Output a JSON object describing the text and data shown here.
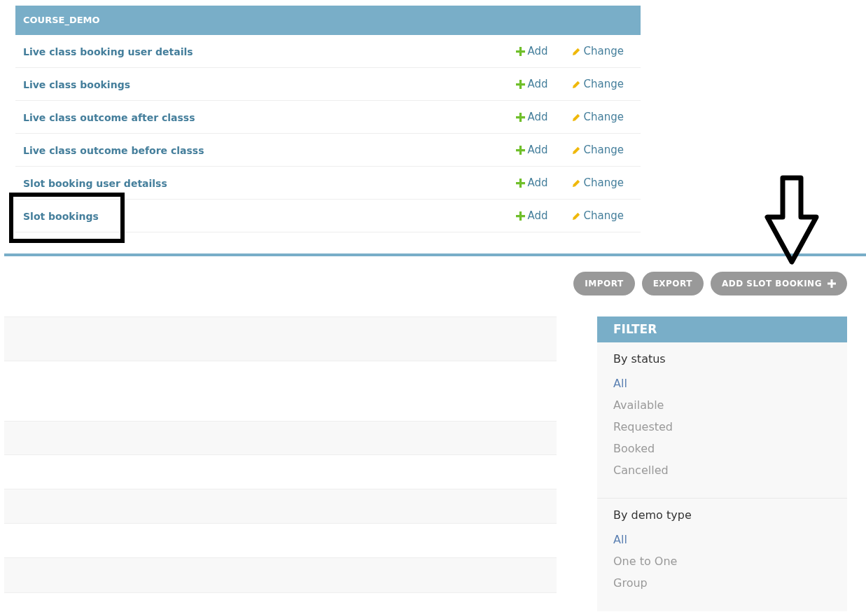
{
  "module": {
    "title": "COURSE_DEMO",
    "models": [
      {
        "name": "Live class booking user details",
        "add": "Add",
        "change": "Change",
        "highlighted": false
      },
      {
        "name": "Live class bookings",
        "add": "Add",
        "change": "Change",
        "highlighted": false
      },
      {
        "name": "Live class outcome after classs",
        "add": "Add",
        "change": "Change",
        "highlighted": false
      },
      {
        "name": "Live class outcome before classs",
        "add": "Add",
        "change": "Change",
        "highlighted": false
      },
      {
        "name": "Slot booking user detailss",
        "add": "Add",
        "change": "Change",
        "highlighted": false
      },
      {
        "name": "Slot bookings",
        "add": "Add",
        "change": "Change",
        "highlighted": true
      }
    ]
  },
  "toolbar": {
    "buttons": [
      {
        "label": "IMPORT",
        "kind": "plain",
        "pointed": false
      },
      {
        "label": "EXPORT",
        "kind": "plain",
        "pointed": false
      },
      {
        "label": "ADD SLOT BOOKING",
        "kind": "add",
        "pointed": true
      }
    ]
  },
  "filter": {
    "title": "FILTER",
    "groups": [
      {
        "title": "By status",
        "choices": [
          {
            "label": "All",
            "selected": true
          },
          {
            "label": "Available",
            "selected": false
          },
          {
            "label": "Requested",
            "selected": false
          },
          {
            "label": "Booked",
            "selected": false
          },
          {
            "label": "Cancelled",
            "selected": false
          }
        ]
      },
      {
        "title": "By demo type",
        "choices": [
          {
            "label": "All",
            "selected": true
          },
          {
            "label": "One to One",
            "selected": false
          },
          {
            "label": "Group",
            "selected": false
          }
        ]
      }
    ]
  }
}
